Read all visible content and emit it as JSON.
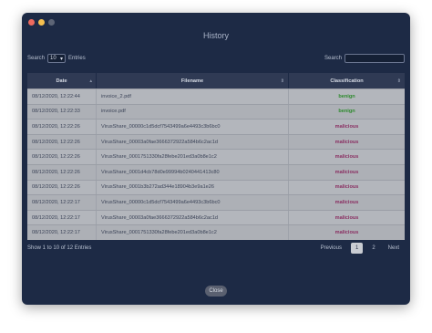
{
  "window": {
    "title": "History"
  },
  "controls": {
    "search_label_left": "Search",
    "entries_value": "10",
    "entries_label": "Entries",
    "search_label_right": "Search"
  },
  "table": {
    "headers": [
      "Date",
      "Filename",
      "Classification"
    ],
    "rows": [
      {
        "date": "08/12/2020, 12:22:44",
        "filename": "invoice_2.pdf",
        "class": "benign"
      },
      {
        "date": "08/12/2020, 12:22:33",
        "filename": "invoice.pdf",
        "class": "benign"
      },
      {
        "date": "08/12/2020, 12:22:26",
        "filename": "VirusShare_00000c1d5dcf7543499a6e4493c3b6bc0",
        "class": "malicious"
      },
      {
        "date": "08/12/2020, 12:22:26",
        "filename": "VirusShare_00003a0fae3666372922a584b6c2ac1d",
        "class": "malicious"
      },
      {
        "date": "08/12/2020, 12:22:26",
        "filename": "VirusShare_0001751330fa28febe201ed3a0b8e1c2",
        "class": "malicious"
      },
      {
        "date": "08/12/2020, 12:22:26",
        "filename": "VirusShare_0001d4cb78d0e99994b0240441413c80",
        "class": "malicious"
      },
      {
        "date": "08/12/2020, 12:22:26",
        "filename": "VirusShare_0001b3b272ad344e18904b3e9a1e26",
        "class": "malicious"
      },
      {
        "date": "08/12/2020, 12:22:17",
        "filename": "VirusShare_00000c1d5dcf7543499a6e4493c3b6bc0",
        "class": "malicious"
      },
      {
        "date": "08/12/2020, 12:22:17",
        "filename": "VirusShare_00003a0fae3666372922a584b6c2ac1d",
        "class": "malicious"
      },
      {
        "date": "08/12/2020, 12:22:17",
        "filename": "VirusShare_0001751330fa28febe201ed3a0b8e1c2",
        "class": "malicious"
      }
    ]
  },
  "footer": {
    "info": "Show 1 to 10 of 12 Entries",
    "previous": "Previous",
    "page1": "1",
    "page2": "2",
    "next": "Next"
  },
  "close_label": "Close",
  "colors": {
    "benign": "#2d8a2d",
    "malicious": "#8a2f62",
    "window_bg": "#1d2a45"
  }
}
